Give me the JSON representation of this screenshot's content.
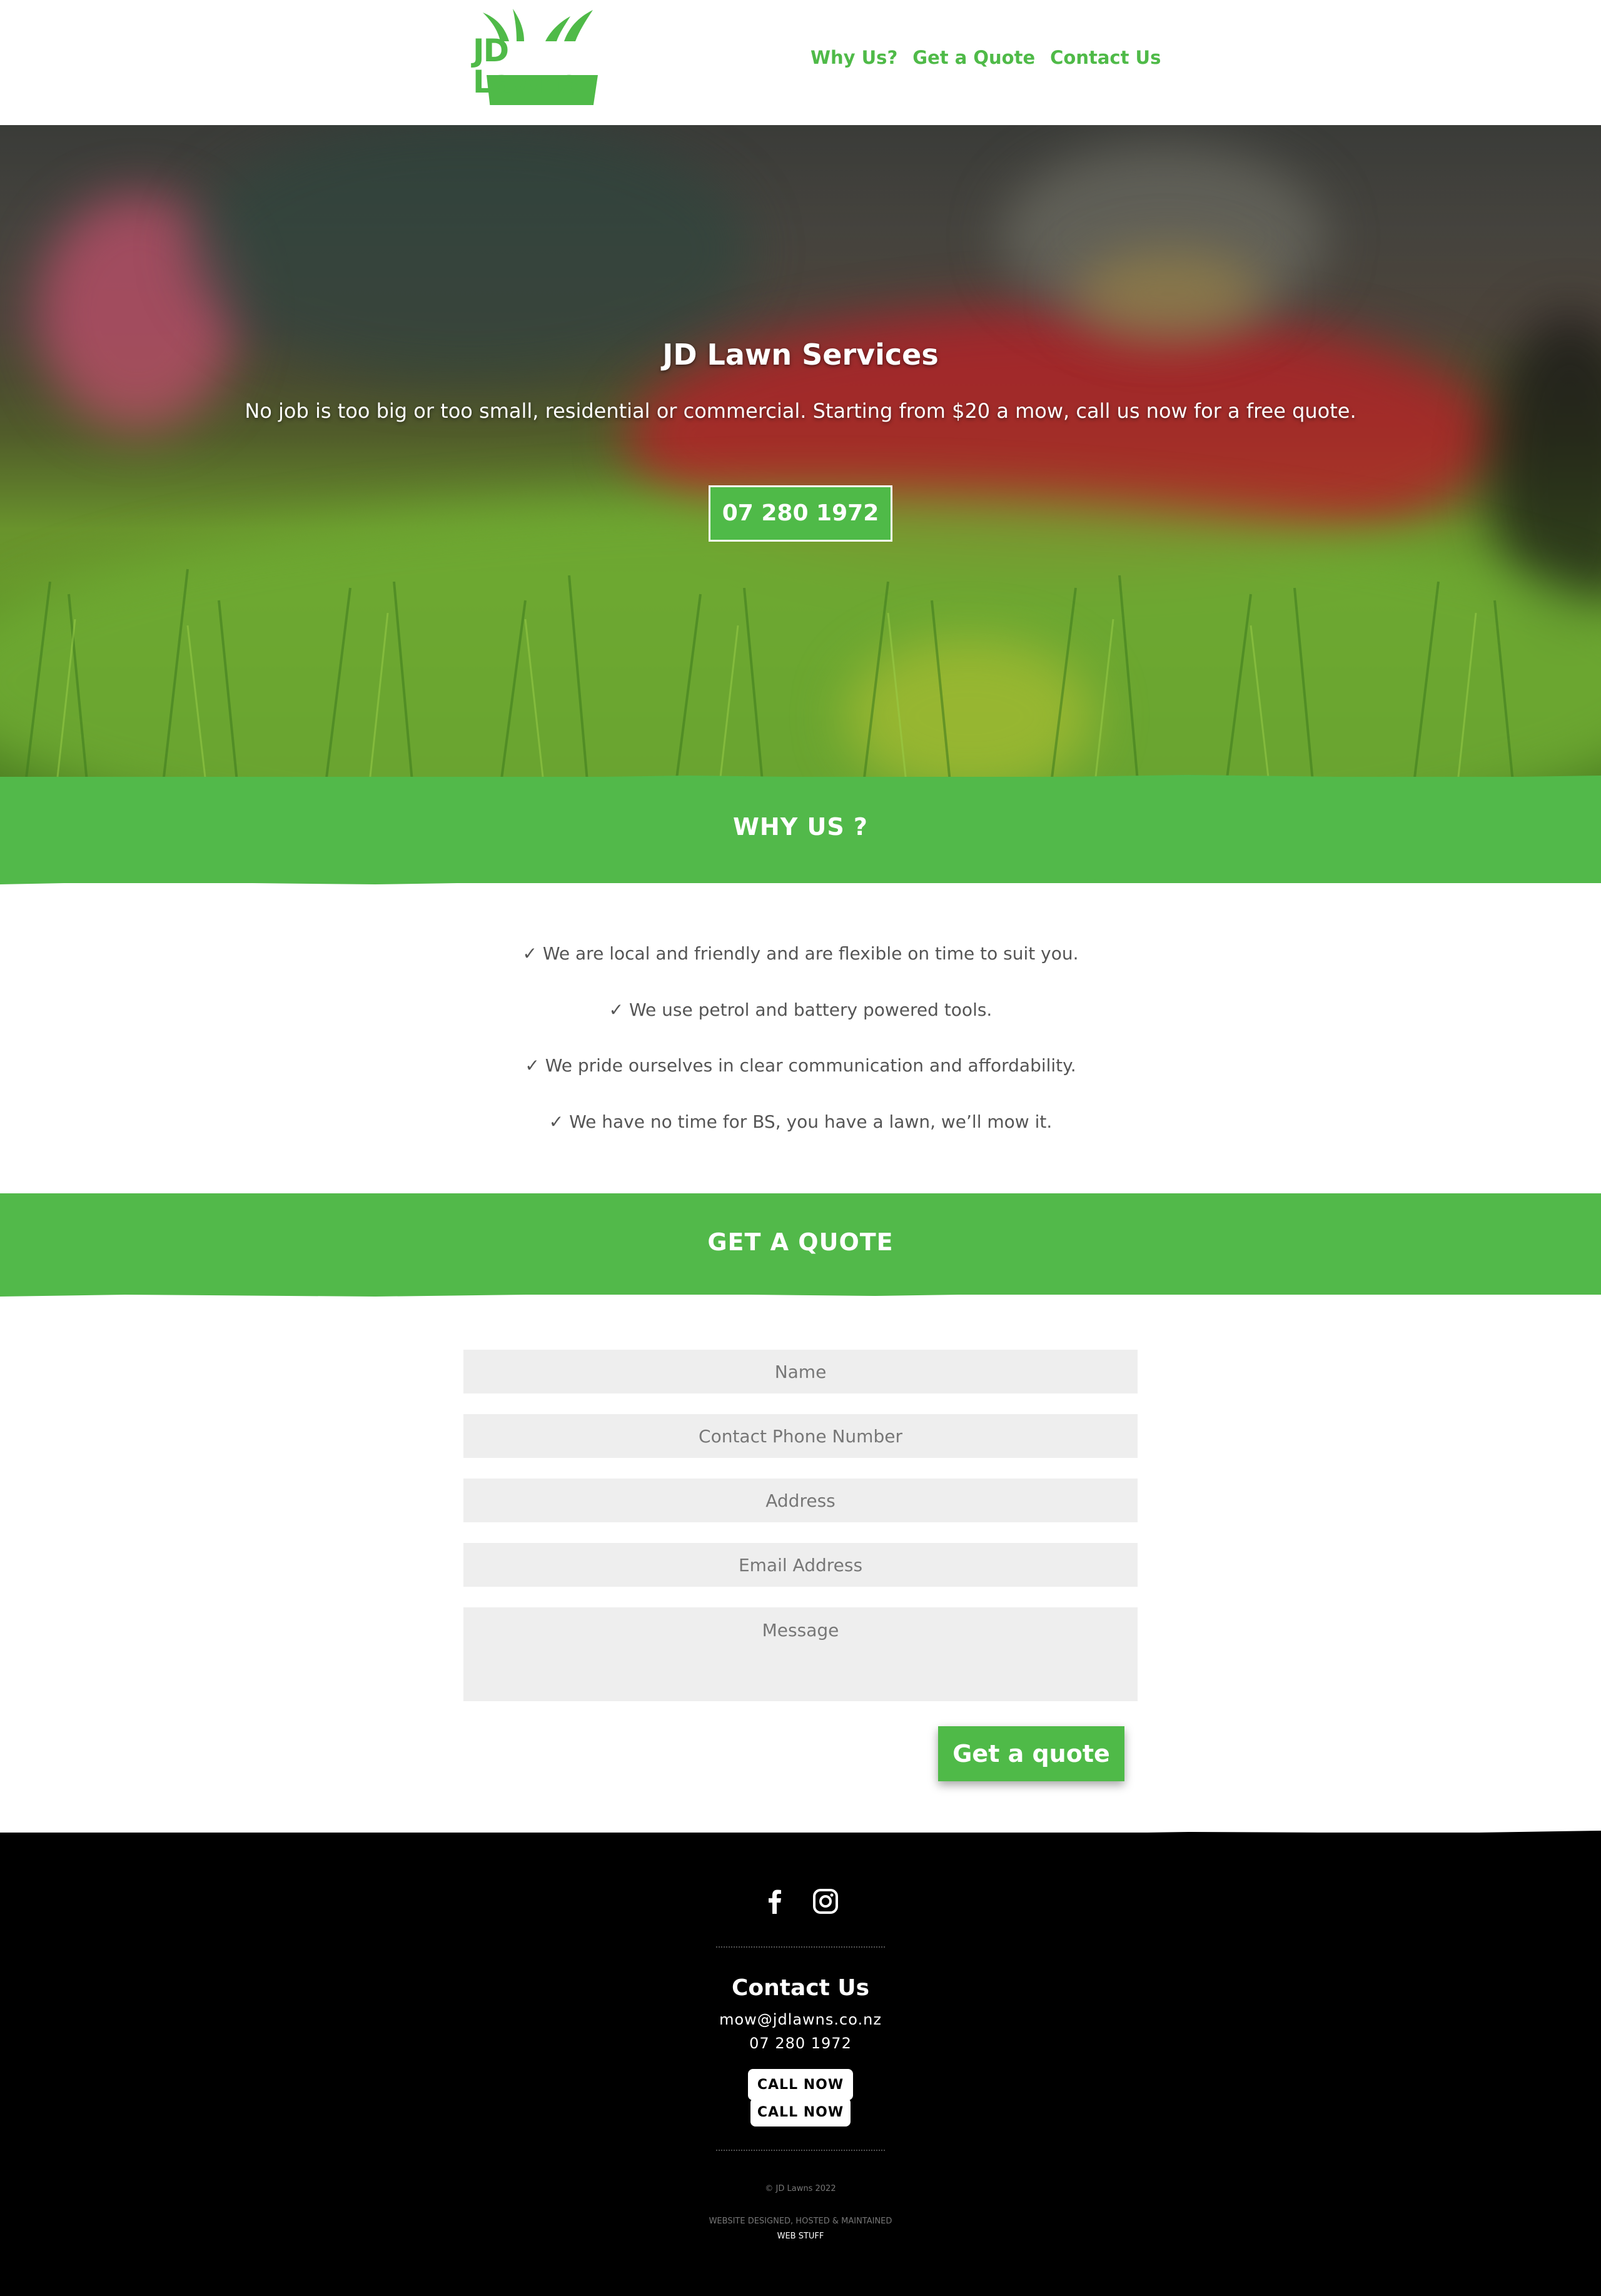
{
  "header": {
    "logo_text": "JD Lawns",
    "nav": [
      "Why Us?",
      "Get a Quote",
      "Contact Us"
    ]
  },
  "hero": {
    "title": "JD Lawn Services",
    "subtitle": "No job is too big or too small, residential or commercial.  Starting from $20 a mow, call us now for a free quote.",
    "phone_button": "07 280 1972"
  },
  "why_us": {
    "heading": "WHY US ?",
    "items": [
      "✓  We are local and friendly and are flexible on time to suit you.",
      "✓  We use petrol and battery powered tools.",
      "✓  We pride ourselves in clear communication and affordability.",
      "✓  We have no time for BS, you have a lawn, we’ll mow it."
    ]
  },
  "quote": {
    "heading": "GET A QUOTE",
    "placeholders": {
      "name": "Name",
      "phone": "Contact Phone Number",
      "address": "Address",
      "email": "Email Address",
      "message": "Message"
    },
    "submit": "Get a quote"
  },
  "footer": {
    "social_icons": [
      "facebook-icon",
      "instagram-icon"
    ],
    "heading": "Contact Us",
    "email": "mow@jdlawns.co.nz",
    "phone": "07 280 1972",
    "call_buttons": [
      "CALL NOW",
      "CALL NOW"
    ],
    "copyright": "© JD Lawns 2022",
    "credit_line": "WEBSITE DESIGNED, HOSTED & MAINTAINED",
    "credit_name": "WEB STUFF"
  },
  "colors": {
    "brand_green": "#4fba48",
    "band_green": "#52b94a",
    "footer_bg": "#000000",
    "field_bg": "#eeeeee"
  }
}
